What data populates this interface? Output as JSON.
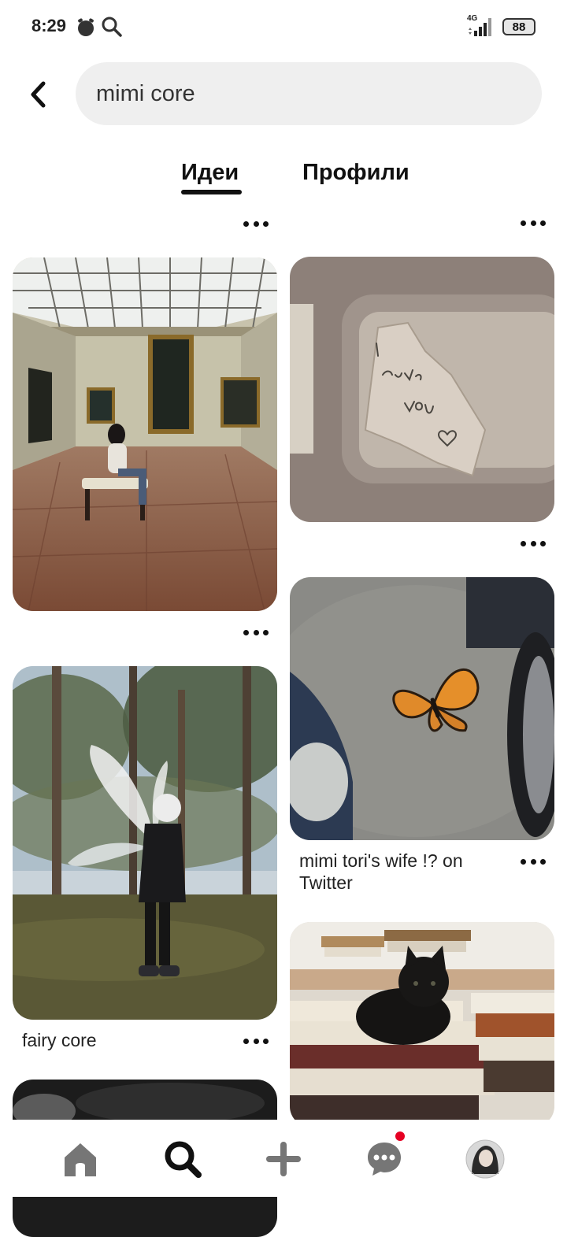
{
  "status_bar": {
    "time": "8:29",
    "network": "4G",
    "battery": "88"
  },
  "search": {
    "query": "mimi core"
  },
  "tabs": [
    {
      "label": "Идеи",
      "active": true
    },
    {
      "label": "Профили",
      "active": false
    }
  ],
  "pins": [
    {
      "column": "left",
      "image": "museum-gallery-photo",
      "caption": ""
    },
    {
      "column": "left",
      "image": "fairy-wings-forest-photo",
      "caption": "fairy core"
    },
    {
      "column": "left",
      "image": "dark-photo",
      "caption": ""
    },
    {
      "column": "right",
      "image": "love-you-note-visor-photo",
      "caption": ""
    },
    {
      "column": "right",
      "image": "butterfly-parking-lot-photo",
      "caption": "mimi tori's wife !? on Twitter"
    },
    {
      "column": "right",
      "image": "black-kitten-books-photo",
      "caption": ""
    }
  ],
  "bottom_nav": [
    {
      "icon": "home-icon"
    },
    {
      "icon": "search-icon",
      "active": true
    },
    {
      "icon": "plus-icon"
    },
    {
      "icon": "messages-icon",
      "badge": true
    },
    {
      "icon": "profile-avatar"
    }
  ],
  "colors": {
    "accent_badge": "#e60023",
    "search_bg": "#efefef"
  }
}
